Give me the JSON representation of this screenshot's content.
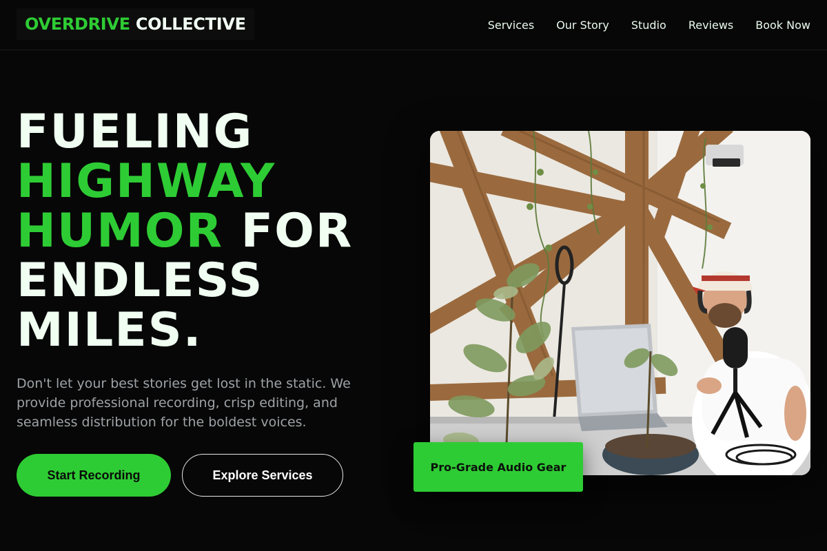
{
  "brand": {
    "word1": "OVERDRIVE",
    "word2": "COLLECTIVE"
  },
  "nav": {
    "items": [
      "Services",
      "Our Story",
      "Studio",
      "Reviews",
      "Book Now"
    ]
  },
  "hero": {
    "headline": {
      "line1": "FUELING",
      "line2": "HIGHWAY",
      "line3_green": "HUMOR",
      "line3_rest": "FOR",
      "line4": "ENDLESS",
      "line5": "MILES."
    },
    "lead": "Don't let your best stories get lost in the static. We provide professional recording, crisp editing, and seamless distribution for the boldest voices.",
    "primary_cta": "Start Recording",
    "secondary_cta": "Explore Services",
    "image_badge": "Pro-Grade Audio Gear"
  },
  "colors": {
    "background": "#070707",
    "accent": "#2ecc34",
    "text": "#f0fff2",
    "muted": "#9ea3a6"
  },
  "icons": {
    "hero_image": "podcast-studio-photo"
  }
}
